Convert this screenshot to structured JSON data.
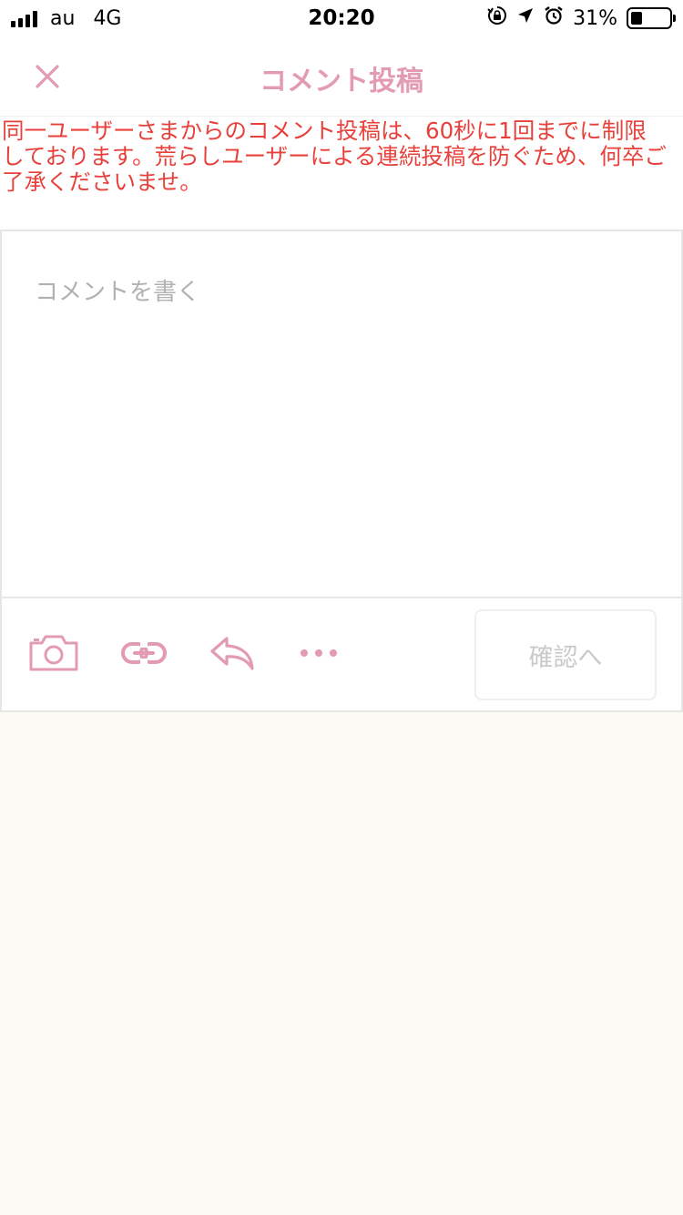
{
  "status_bar": {
    "carrier": "au",
    "network": "4G",
    "time": "20:20",
    "battery": "31%",
    "battery_level": 0.31
  },
  "nav": {
    "title": "コメント投稿",
    "close_icon": "close-icon"
  },
  "notice": {
    "text": "同一ユーザーさまからのコメント投稿は、60秒に1回までに制限しております。荒らしユーザーによる連続投稿を防ぐため、何卒ご了承くださいませ。"
  },
  "editor": {
    "placeholder": "コメントを書く",
    "value": ""
  },
  "toolbar": {
    "icons": [
      "camera-icon",
      "link-icon",
      "reply-icon",
      "more-icon"
    ],
    "confirm_label": "確認へ"
  },
  "colors": {
    "accent": "#e39bb3",
    "notice": "#e8403a",
    "background": "#fdf9f4",
    "placeholder": "#b1b1b1"
  }
}
